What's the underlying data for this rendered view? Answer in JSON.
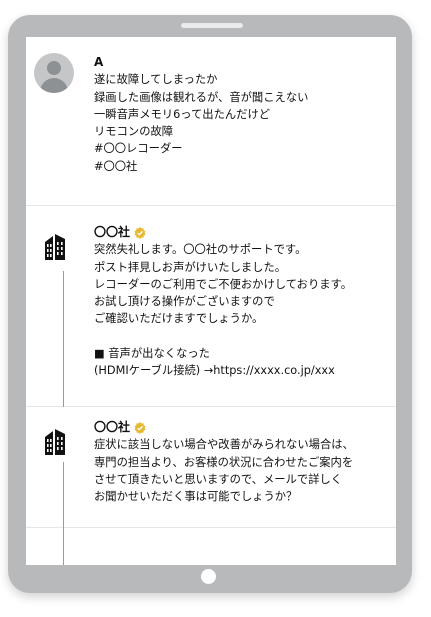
{
  "posts": [
    {
      "author": "A",
      "lines": [
        "遂に故障してしまったか",
        "録画した画像は観れるが、音が聞こえない",
        "一瞬音声メモリ6って出たんだけど",
        "リモコンの故障",
        "#〇〇レコーダー",
        "#〇〇社"
      ]
    },
    {
      "author": "〇〇社",
      "lines": [
        "突然失礼します。〇〇社のサポートです。",
        "ポスト拝見しお声がけいたしました。",
        "レコーダーのご利用でご不便おかけしております。",
        "お試し頂ける操作がございますので",
        "ご確認いただけますでしょうか。",
        "",
        "■ 音声が出なくなった",
        "(HDMIケーブル接続) →https://xxxx.co.jp/xxx"
      ]
    },
    {
      "author": "〇〇社",
      "lines": [
        "症状に該当しない場合や改善がみられない場合は、",
        "専門の担当より、お客様の状況に合わせたご案内を",
        "させて頂きたいと思いますので、メールで詳しく",
        "お聞かせいただく事は可能でしょうか？"
      ]
    }
  ],
  "icons": {
    "avatar": "user-avatar-icon",
    "company": "building-icon",
    "verified": "verified-badge-icon"
  },
  "colors": {
    "device_frame": "#b7b9bb",
    "verified_badge": "#e8b830"
  }
}
